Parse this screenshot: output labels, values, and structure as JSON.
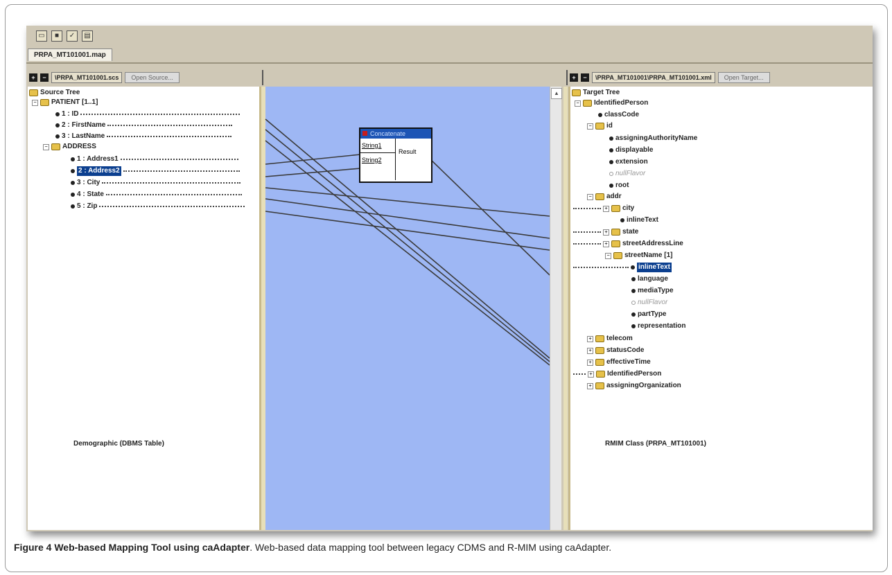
{
  "toolbar": {
    "icons": [
      "folder-open-icon",
      "save-icon",
      "validate-icon",
      "document-icon"
    ]
  },
  "tab": {
    "label": "PRPA_MT101001.map"
  },
  "source": {
    "path": "\\PRPA_MT101001.scs",
    "button": "Open Source...",
    "tree_root": "Source Tree",
    "patient": "PATIENT [1..1]",
    "fields": [
      "1 : ID",
      "2 : FirstName",
      "3 : LastName"
    ],
    "address": "ADDRESS",
    "address_fields": [
      "1 : Address1",
      "2 : Address2",
      "3 : City",
      "4 : State",
      "5 : Zip"
    ],
    "caption": "Demographic (DBMS Table)"
  },
  "function": {
    "title": "Concatenate",
    "inputs": [
      "String1",
      "String2"
    ],
    "output": "Result"
  },
  "target": {
    "path": "\\PRPA_MT101001\\PRPA_MT101001.xml",
    "button": "Open Target...",
    "tree_root": "Target Tree",
    "identified_person": "IdentifiedPerson",
    "class_code": "classCode",
    "id": "id",
    "id_fields": [
      "assigningAuthorityName",
      "displayable",
      "extension",
      "nullFlavor",
      "root"
    ],
    "addr": "addr",
    "city": "city",
    "inline_text": "inlineText",
    "state": "state",
    "street_address_line": "streetAddressLine",
    "street_name": "streetName [1]",
    "street_fields": [
      "inlineText",
      "language",
      "mediaType",
      "nullFlavor",
      "partType",
      "representation"
    ],
    "more": [
      "telecom",
      "statusCode",
      "effectiveTime",
      "IdentifiedPerson",
      "assigningOrganization"
    ],
    "caption": "RMIM Class (PRPA_MT101001)"
  },
  "figure_caption": {
    "label": "Figure 4 Web-based Mapping Tool using caAdapter",
    "text": ". Web-based data mapping tool between legacy CDMS and R-MIM using caAdapter."
  }
}
